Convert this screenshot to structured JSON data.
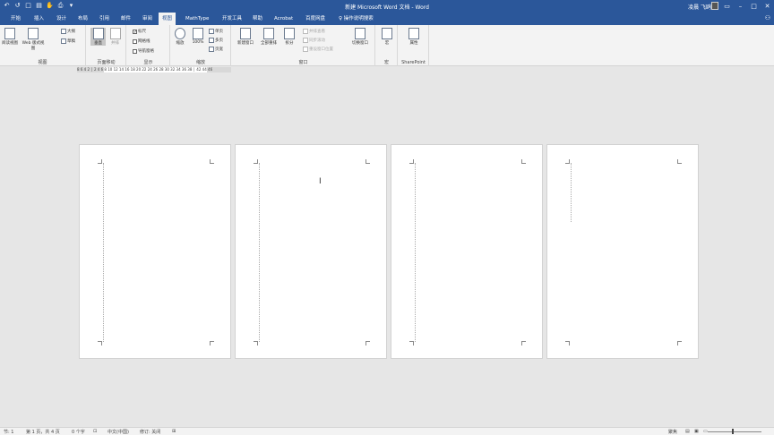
{
  "titlebar": {
    "title": "新建 Microsoft Word 文档 - Word",
    "user": "凌晨 飞鸥",
    "qat_icons": [
      "undo-icon",
      "redo-icon",
      "new-icon",
      "open-icon",
      "touch-icon",
      "print-icon",
      "customize-icon"
    ],
    "qat_glyphs": [
      "↶",
      "↺",
      "□",
      "▤",
      "✋",
      "⎙",
      "▾"
    ],
    "win": {
      "ribbon_opts": "▭",
      "minimize": "–",
      "maximize": "□",
      "close": "✕"
    }
  },
  "tabs": [
    "开始",
    "插入",
    "设计",
    "布局",
    "引用",
    "邮件",
    "审阅",
    "视图",
    "MathType",
    "开发工具",
    "帮助",
    "Acrobat",
    "百度网盘",
    "操作说明搜索"
  ],
  "active_tab": "视图",
  "ribbon": {
    "views": {
      "label": "视图",
      "read_mode": "阅读视图",
      "print_layout": "页面视图",
      "web_layout": "Web 版式视图",
      "outline": "大纲",
      "draft": "草稿"
    },
    "page_movement": {
      "label": "页面移动",
      "vertical": "垂直",
      "side_to_side": "并排"
    },
    "show": {
      "label": "显示",
      "ruler": "标尺",
      "gridlines": "网格线",
      "nav_pane": "导航窗格"
    },
    "zoom": {
      "label": "缩放",
      "zoom": "缩放",
      "hundred": "100%",
      "one_page": "单页",
      "multi_page": "多页",
      "page_width": "页宽"
    },
    "window": {
      "label": "窗口",
      "new_window": "新建窗口",
      "arrange_all": "全部重排",
      "split": "拆分",
      "side_by_side": "并排查看",
      "sync_scroll": "同步滚动",
      "reset_pos": "重设窗口位置",
      "switch_window": "切换窗口"
    },
    "macros": {
      "label": "宏",
      "macros": "宏"
    },
    "sharepoint": {
      "label": "SharePoint",
      "properties": "属性"
    }
  },
  "ruler_text": "8 6 4 2 │ 2 4 6 8 10 12 14 16 18 20 22 24 26 28 30 32 34 36 38 │ 42 44 46",
  "status": {
    "section": "节: 1",
    "page": "第 1 页，共 4 页",
    "words": "0 个字",
    "language": "中文(中国)",
    "track_changes": "修订: 关闭",
    "focus": "聚焦"
  }
}
